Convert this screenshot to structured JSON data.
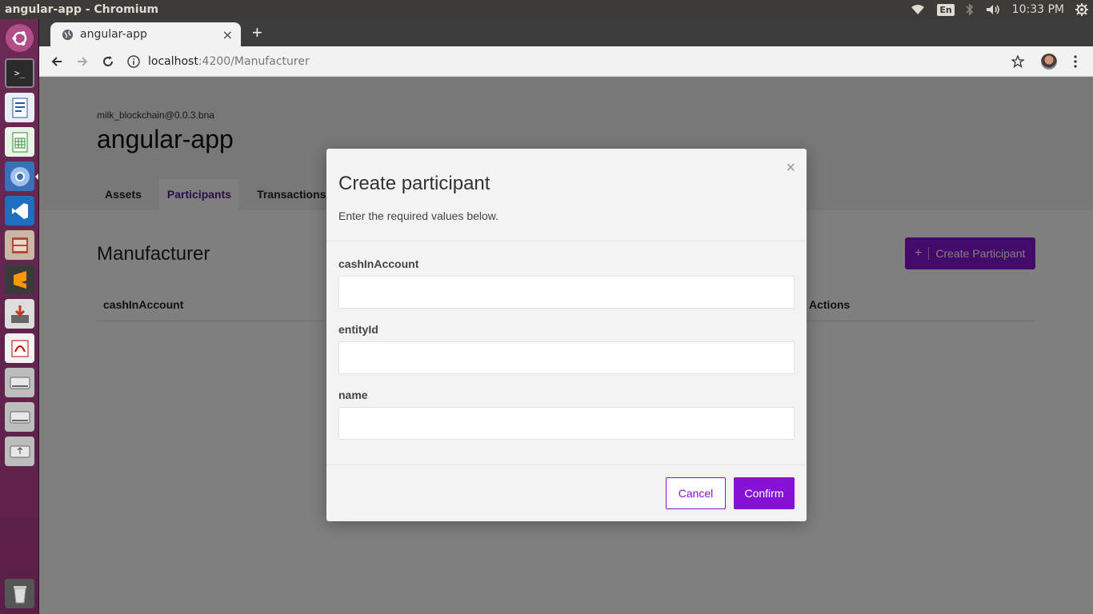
{
  "system": {
    "window_title": "angular-app - Chromium",
    "keyboard_layout": "En",
    "clock": "10:33 PM"
  },
  "browser": {
    "tab_title": "angular-app",
    "new_tab_symbol": "+",
    "close_symbol": "×",
    "url_host": "localhost",
    "url_rest": ":4200/Manufacturer"
  },
  "page": {
    "bna": "milk_blockchain@0.0.3.bna",
    "title": "angular-app",
    "nav": {
      "assets": "Assets",
      "participants": "Participants",
      "transactions": "Transactions"
    },
    "section_title": "Manufacturer",
    "create_button": "Create Participant",
    "create_icon": "+",
    "table_headers": {
      "cash": "cashInAccount",
      "actions": "Actions"
    }
  },
  "modal": {
    "close_symbol": "×",
    "title": "Create participant",
    "subtitle": "Enter the required values below.",
    "fields": [
      {
        "label": "cashInAccount",
        "value": ""
      },
      {
        "label": "entityId",
        "value": ""
      },
      {
        "label": "name",
        "value": ""
      }
    ],
    "cancel_label": "Cancel",
    "confirm_label": "Confirm"
  },
  "colors": {
    "accent": "#8612d6",
    "active_tab_text": "#5b1a8b",
    "launcher": "#5e2150"
  }
}
